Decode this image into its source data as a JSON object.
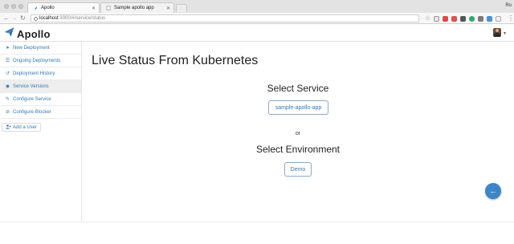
{
  "browser": {
    "tabs": [
      {
        "title": "Apollo",
        "active": true
      },
      {
        "title": "Sample apollo app",
        "active": false
      }
    ],
    "profile_label": "Ro",
    "url": {
      "host": "localhost",
      "rest": ":3000/#/service/status"
    }
  },
  "app": {
    "brand": "Apollo",
    "accent_color": "#337ab7"
  },
  "sidebar": {
    "items": [
      {
        "label": "New Deployment",
        "icon": "paper-plane-icon",
        "glyph": "➤"
      },
      {
        "label": "Ongoing Deployments",
        "icon": "list-icon",
        "glyph": "☰"
      },
      {
        "label": "Deployment History",
        "icon": "history-icon",
        "glyph": "↺"
      },
      {
        "label": "Service Versions",
        "icon": "eye-icon",
        "glyph": "◉"
      },
      {
        "label": "Configure Service",
        "icon": "edit-icon",
        "glyph": "✎"
      },
      {
        "label": "Configure Blocker",
        "icon": "ban-icon",
        "glyph": "⊘"
      }
    ],
    "add_user_label": "Add a User"
  },
  "main": {
    "title": "Live Status From Kubernetes",
    "select_service_heading": "Select Service",
    "service_button": "sample-apollo-app",
    "or_label": "or",
    "select_environment_heading": "Select Environment",
    "environment_button": "Demo"
  }
}
